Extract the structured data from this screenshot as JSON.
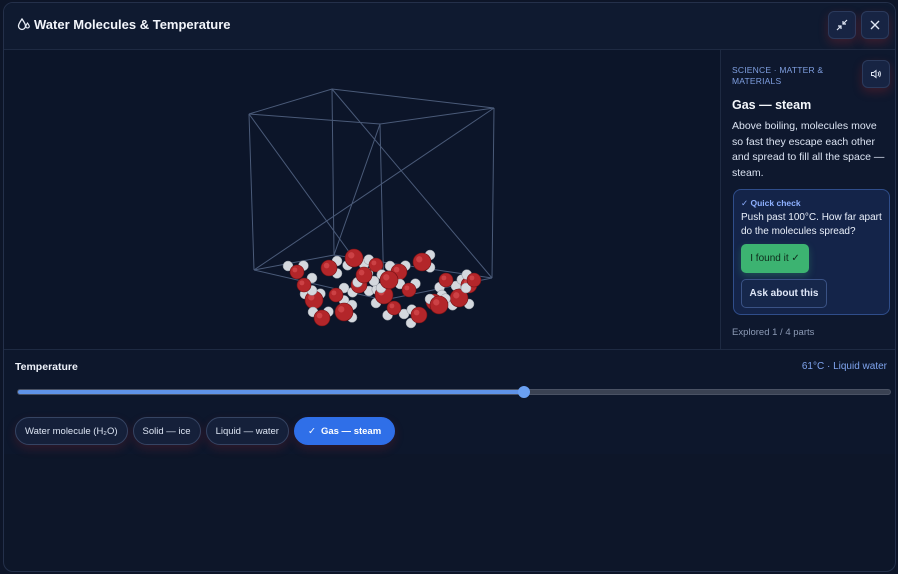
{
  "window": {
    "title": "Water Molecules & Temperature",
    "icons": {
      "title": "droplets-icon",
      "collapse": "minimize-arrows-icon",
      "close": "close-icon"
    }
  },
  "sidebar": {
    "breadcrumb": "SCIENCE · MATTER & MATERIALS",
    "audio_icon": "speaker-icon",
    "heading": "Gas — steam",
    "description": "Above boiling, molecules move so fast they escape each other and spread to fill all the space — steam.",
    "quick_check": {
      "label": "✓ Quick check",
      "question": "Push past 100°C. How far apart do the molecules spread?",
      "found_label": "I found it ✓",
      "ask_label": "Ask about this"
    },
    "progress": "Explored 1 / 4 parts"
  },
  "controls": {
    "temperature_label": "Temperature",
    "temperature_readout": "61°C · Liquid water",
    "slider_fraction": 0.58,
    "chips": [
      {
        "label": "Water molecule (H₂O)",
        "active": false
      },
      {
        "label": "Solid — ice",
        "active": false
      },
      {
        "label": "Liquid — water",
        "active": false
      },
      {
        "label": "Gas — steam",
        "active": true
      }
    ],
    "active_check": "✓"
  },
  "colors": {
    "oxygen": "#b3262a",
    "hydrogen": "#d4d8de",
    "accent": "#2f6fe8",
    "success": "#3cb371"
  }
}
